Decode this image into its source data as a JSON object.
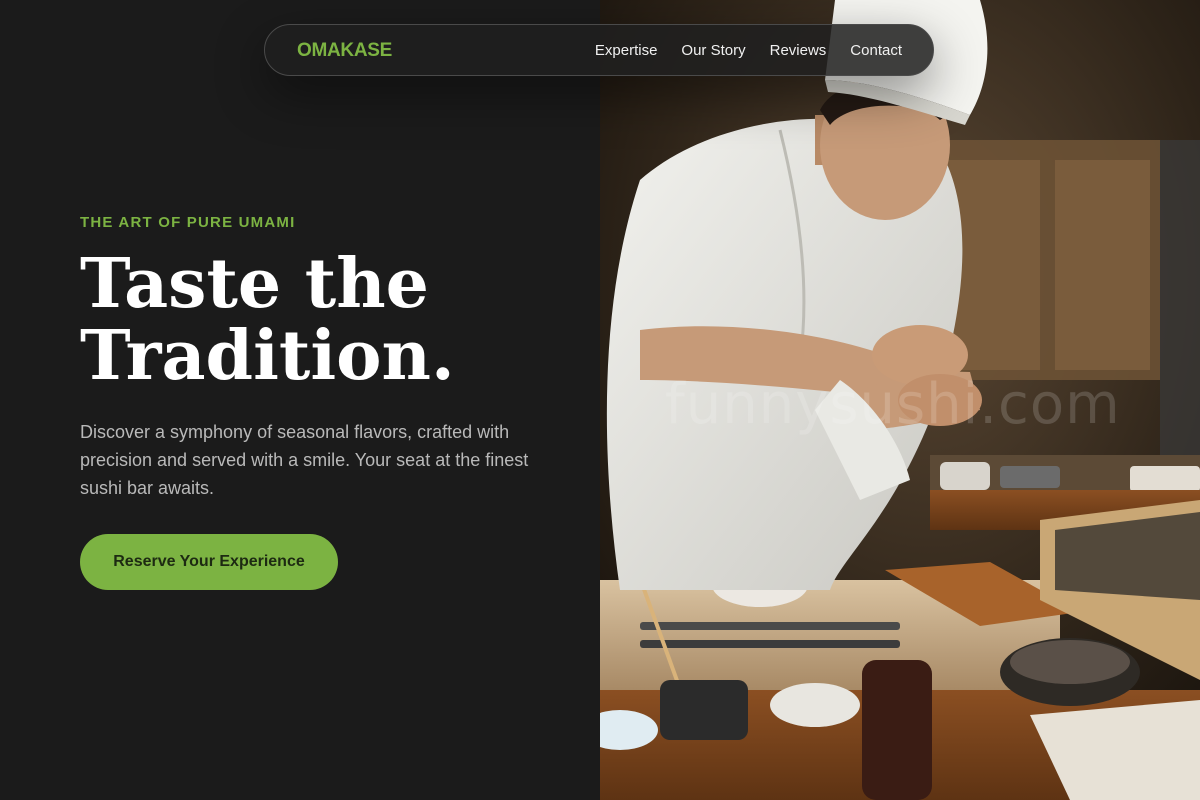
{
  "nav": {
    "brand": "OMAKASE",
    "links": [
      "Expertise",
      "Our Story",
      "Reviews",
      "Contact"
    ]
  },
  "hero": {
    "eyebrow": "THE ART OF PURE UMAMI",
    "headline": [
      "Taste the",
      "Tradition."
    ],
    "description": "Discover a symphony of seasonal flavors, crafted with precision and served with a smile. Your seat at the finest sushi bar awaits.",
    "cta_label": "Reserve Your Experience"
  },
  "photo": {
    "watermark": "funnysushi.com"
  },
  "colors": {
    "accent": "#7cb342",
    "background": "#1b1b1b",
    "text_muted": "#b9b9b9"
  }
}
